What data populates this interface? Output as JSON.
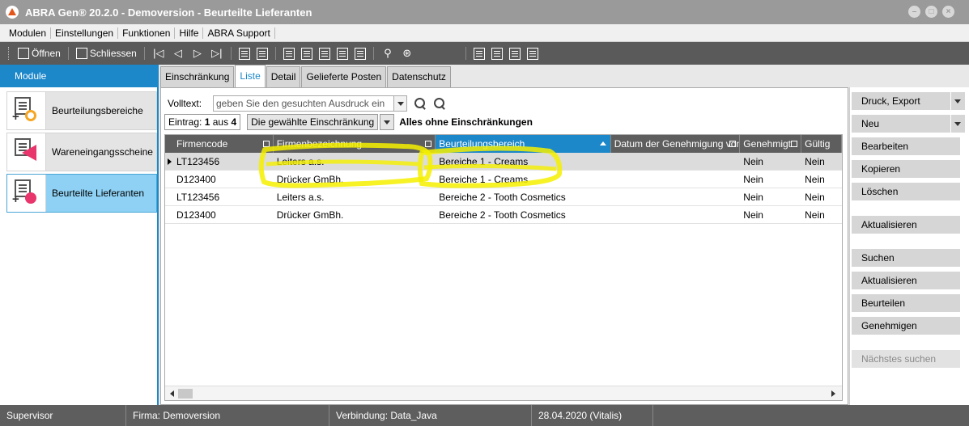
{
  "window": {
    "title": "ABRA Gen® 20.2.0 - Demoversion - Beurteilte Lieferanten"
  },
  "menu": [
    "Modulen",
    "Einstellungen",
    "Funktionen",
    "Hilfe",
    "ABRA Support"
  ],
  "toolbar": {
    "open_label": "Öffnen",
    "close_label": "Schliessen"
  },
  "modules": {
    "header": "Module",
    "items": [
      {
        "label": "Beurteilungsbereiche",
        "icon": "evaluation-areas-icon"
      },
      {
        "label": "Wareneingangsscheine",
        "icon": "goods-receipt-icon"
      },
      {
        "label": "Beurteilte Lieferanten",
        "icon": "rated-suppliers-icon",
        "active": true
      }
    ]
  },
  "tabs": [
    {
      "label": "Einschränkung"
    },
    {
      "label": "Liste",
      "active": true
    },
    {
      "label": "Detail"
    },
    {
      "label": "Gelieferte Posten"
    },
    {
      "label": "Datenschutz"
    }
  ],
  "search": {
    "label": "Volltext:",
    "placeholder": "geben Sie den gesuchten Ausdruck ein"
  },
  "entry": {
    "prefix": "Eintrag:",
    "current": "1",
    "of": "aus",
    "total": "4",
    "filter_button": "Die gewählte Einschränkung",
    "filter_label": "Alles ohne Einschränkungen"
  },
  "grid": {
    "columns": [
      "Firmencode",
      "Firmenbezeichnung",
      "Beurteilungsbereich",
      "Datum der Genehmigung von",
      "Genehmigt",
      "Gültig"
    ],
    "rows": [
      [
        "LT123456",
        "Leiters a.s.",
        "Bereiche 1 - Creams",
        "",
        "Nein",
        "Nein"
      ],
      [
        "D123400",
        "Drücker GmBh.",
        "Bereiche 1 - Creams",
        "",
        "Nein",
        "Nein"
      ],
      [
        "LT123456",
        "Leiters a.s.",
        "Bereiche 2 - Tooth Cosmetics",
        "",
        "Nein",
        "Nein"
      ],
      [
        "D123400",
        "Drücker GmBh.",
        "Bereiche 2 - Tooth Cosmetics",
        "",
        "Nein",
        "Nein"
      ]
    ]
  },
  "actions": {
    "print_export": "Druck, Export",
    "new": "Neu",
    "edit": "Bearbeiten",
    "copy": "Kopieren",
    "delete": "Löschen",
    "refresh1": "Aktualisieren",
    "search": "Suchen",
    "refresh2": "Aktualisieren",
    "evaluate": "Beurteilen",
    "approve": "Genehmigen",
    "find_next": "Nächstes suchen"
  },
  "status": {
    "user": "Supervisor",
    "company": "Firma: Demoversion",
    "connection": "Verbindung: Data_Java",
    "date": "28.04.2020 (Vitalis)"
  },
  "colors": {
    "accent": "#1c87c9",
    "highlight": "#f5f000"
  }
}
